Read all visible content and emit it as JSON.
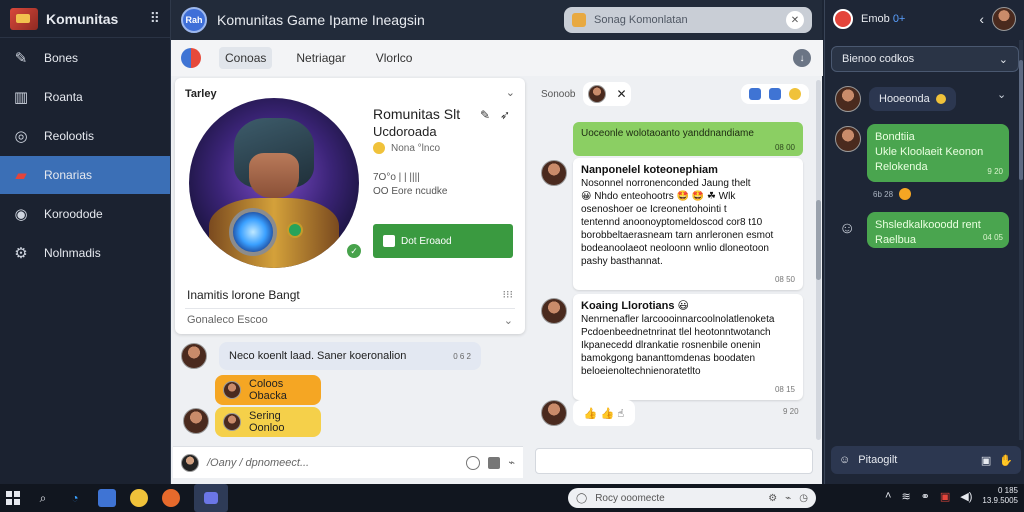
{
  "sidebar": {
    "title": "Komunitas",
    "menu_glyph": "⠿",
    "items": [
      {
        "label": "Bones",
        "icon": "pen-icon"
      },
      {
        "label": "Roanta",
        "icon": "chart-icon"
      },
      {
        "label": "Reolootis",
        "icon": "chat-icon"
      },
      {
        "label": "Ronarias",
        "icon": "gift-icon"
      },
      {
        "label": "Koroodode",
        "icon": "target-icon"
      },
      {
        "label": "Nolnmadis",
        "icon": "gear-icon"
      }
    ],
    "active_index": 3
  },
  "topbar": {
    "avatar_text": "Rah",
    "title": "Komunitas Game Ipame Ineagsin",
    "search_placeholder": "Sonag Komonlatan",
    "search_button": "✕"
  },
  "tabs": {
    "items": [
      "Conoas",
      "Netriagar",
      "Vlorlco"
    ],
    "active_index": 0
  },
  "profile": {
    "header": "Tarley",
    "name": "Romunitas Slt",
    "subtitle": "Ucdoroada",
    "status": "Nona  °lnco",
    "meta1": "7O°o | | ||||",
    "meta2": "OO Eore ncudke",
    "action_label": "Dot Eroaod",
    "bio": "Inamitis lorone Bangt",
    "footer": "Gonaleco Escoo"
  },
  "left_chat": {
    "msg1": "Neco koenlt laad. Saner koeronalion",
    "msg1_time": "0 6 2",
    "pill1": "Coloos Obacka",
    "pill2": "Sering Oonloo",
    "composer_placeholder": "/Oany / dpnomeect..."
  },
  "right_chat": {
    "label": "Sonoob",
    "green1": "Uoceonle wolotaoanto yanddnandiame",
    "green1_time": "08 00",
    "msg1_title": "Nanponelel koteonephiam",
    "msg1_lines": [
      "Nosonnel norronenconded Jaung thelt",
      "😀 Nhdo enteohootrs 🤩 🤩 ☘ Wlk",
      "osenoshoer oe Icreonentohointi t",
      "tentennd anoonoyptomeldoscod cor8 t10",
      "borobbeltaerasneam tarn anrleronen esmot",
      "bodeanoolaeot neoloonn wnlio dloneotoon",
      "pashy basthannat."
    ],
    "msg1_time": "08 50",
    "msg2_title": "Koaing Llorotians 😃",
    "msg2_lines": [
      "Nenrnenafler larcoooinnarcoolnolatlenoketa",
      "Pcdoenbeednetnrinat tlel heotonntwotanch",
      "Ikpanecedd dlrankatie rosnenbile onenin",
      "bamokgong bananttomdenas boodaten",
      "beloeienoltechnienoratetlto"
    ],
    "msg2_time": "08 15",
    "reactions": "👍 👍 ☝",
    "reactions_time": "9 20"
  },
  "rpanel": {
    "title": "Emob",
    "title_suffix": "0+",
    "select_label": "Bienoo codkos",
    "chat1": "Hooeonda",
    "green1": "Bondtiia\nUkle Kloolaeit Keonon\nRelokenda",
    "green1_time": "9 20",
    "time_row": "6b 28",
    "green2": "Shsledkalkooodd rent\nRaelbua",
    "green2_time": "04 05",
    "composer": "Pitaogilt"
  },
  "taskbar": {
    "search_placeholder": "Rocy ooomecte",
    "clock_line1": "0 185",
    "clock_line2": "13.9.5005"
  },
  "colors": {
    "accent": "#3b6fb6",
    "green": "#8bcf63",
    "dark_bg": "#1b2230"
  }
}
